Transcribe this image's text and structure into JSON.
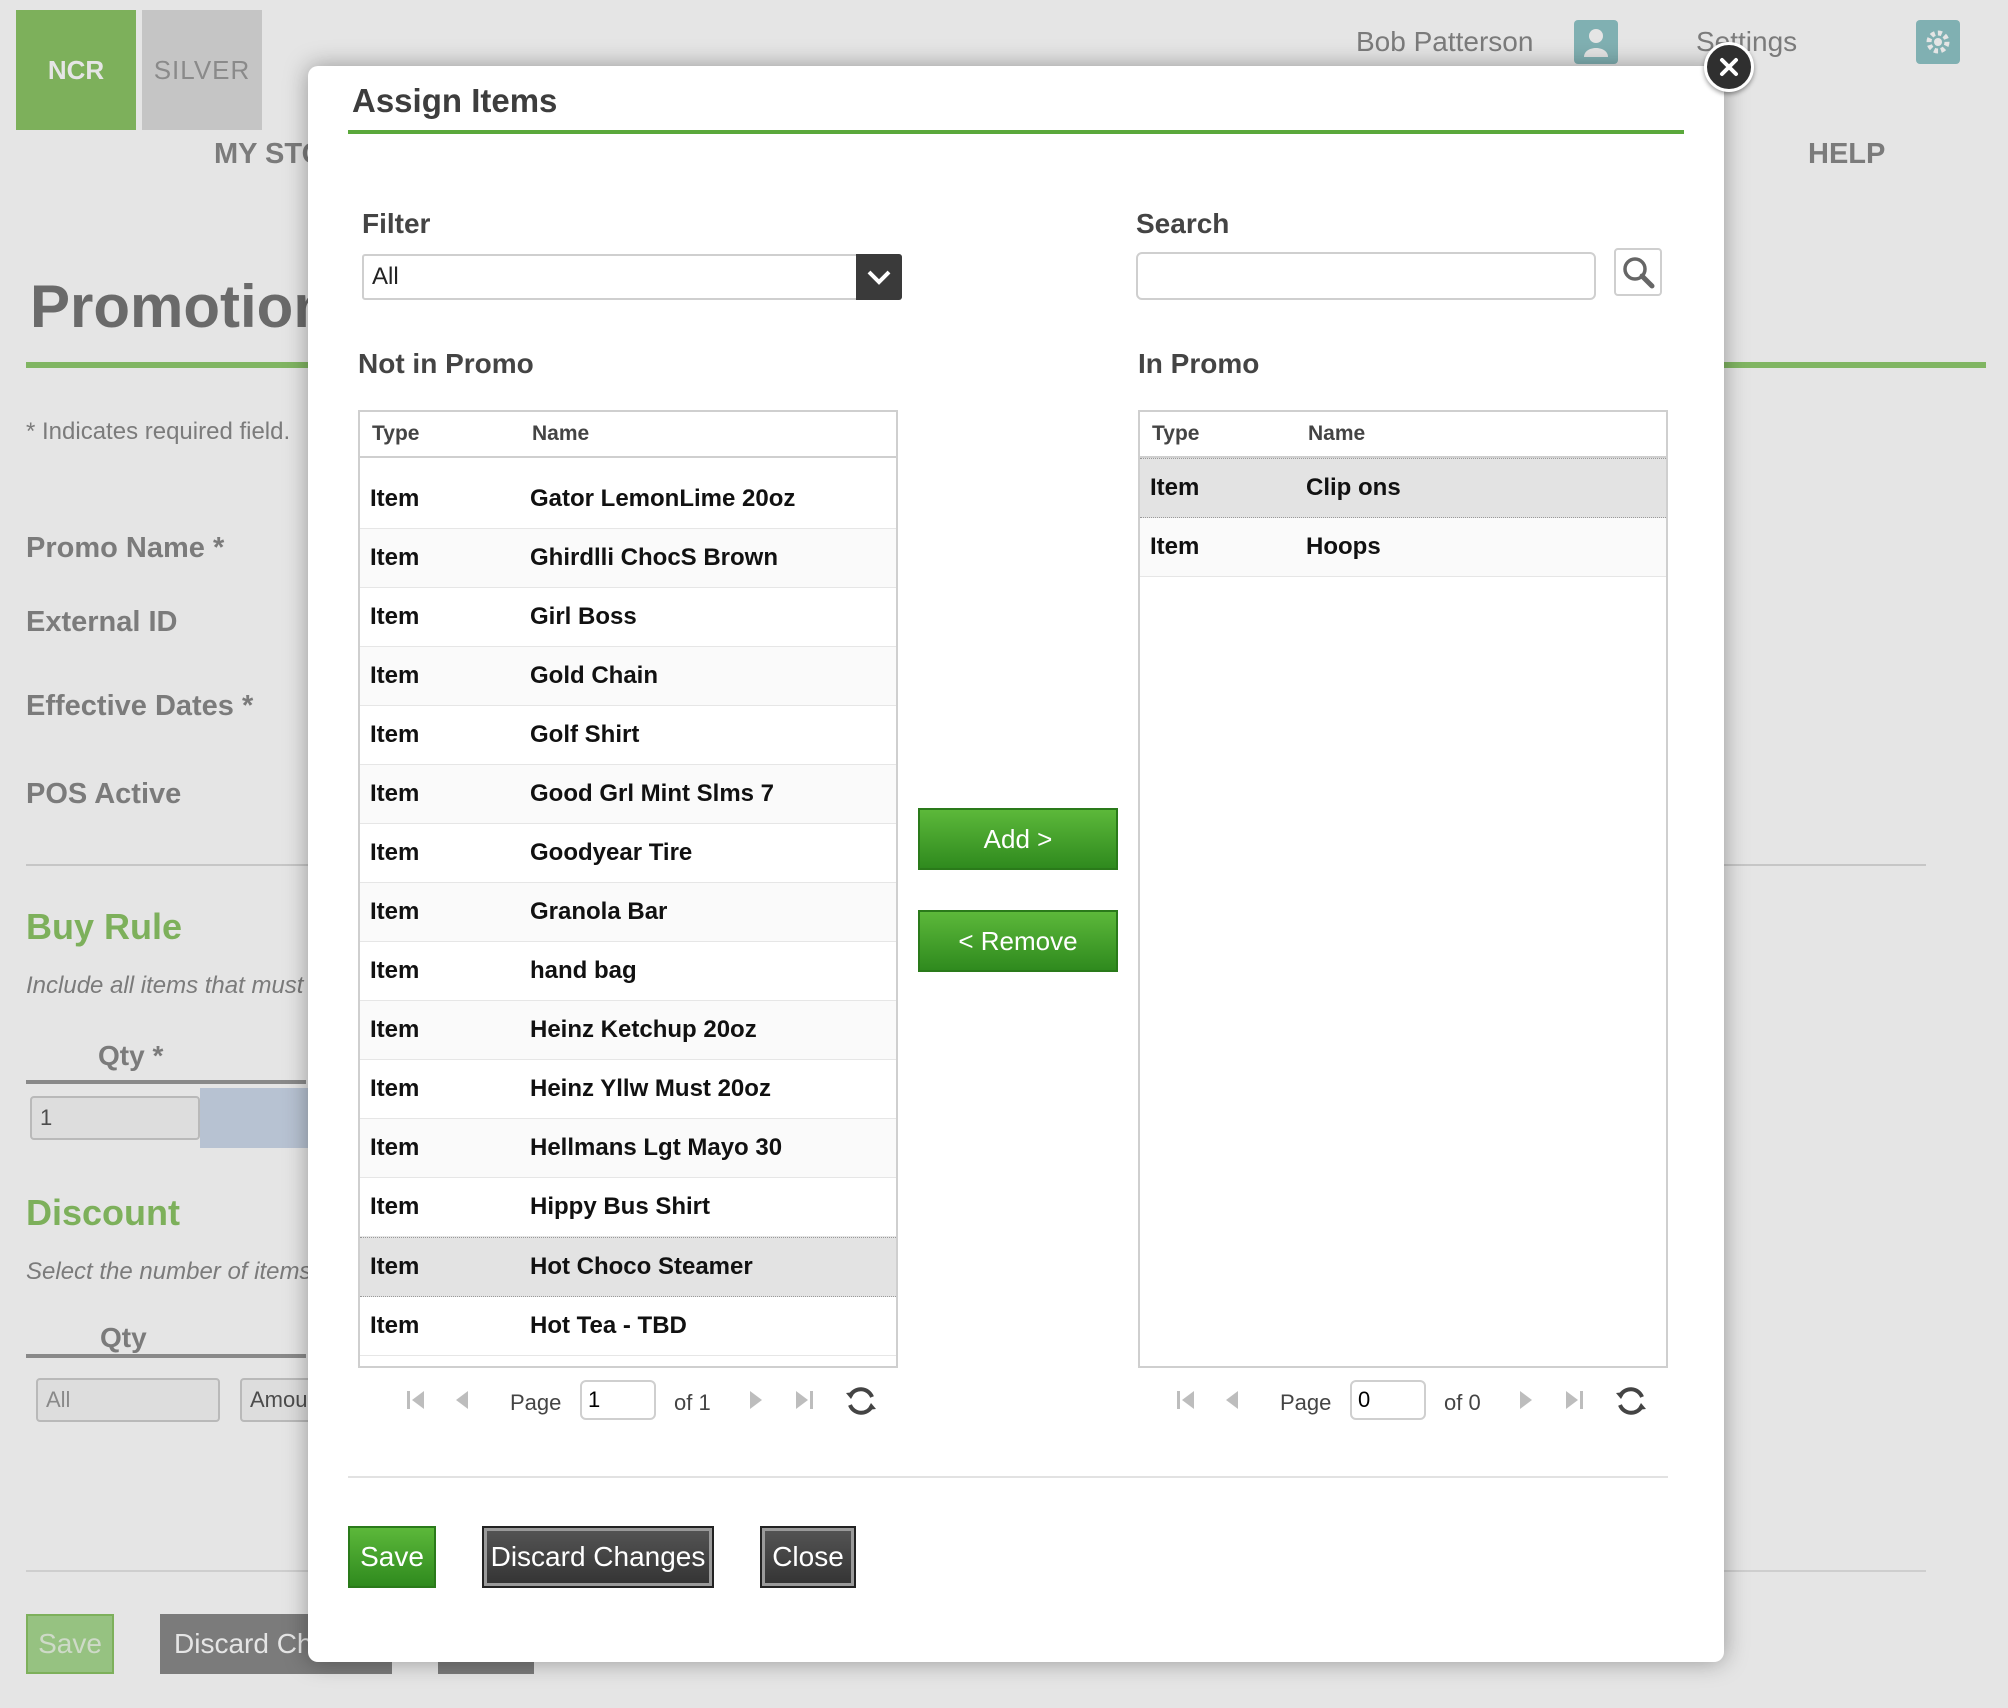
{
  "background": {
    "logo_ncr": "NCR",
    "logo_silver": "SILVER",
    "user_name": "Bob Patterson",
    "settings_label": "Settings",
    "nav_my_store": "MY STO",
    "nav_help": "HELP",
    "page_title": "Promotion",
    "required_note": "* Indicates required field.",
    "promo_name_label": "Promo Name *",
    "external_id_label": "External ID",
    "effective_dates_label": "Effective Dates *",
    "pos_active_label": "POS Active",
    "buy_rule_heading": "Buy Rule",
    "buy_rule_desc": "Include all items that must",
    "qty_required_label": "Qty *",
    "qty_value": "1",
    "discount_heading": "Discount",
    "discount_desc": "Select the number of items",
    "discount_qty_label": "Qty",
    "discount_qty_value": "All",
    "amount_label": "Amou",
    "save_label": "Save",
    "discard_label": "Discard Ch"
  },
  "modal": {
    "title": "Assign Items",
    "filter_label": "Filter",
    "filter_value": "All",
    "search_label": "Search",
    "search_value": "",
    "not_in_promo_label": "Not in Promo",
    "in_promo_label": "In Promo",
    "col_type": "Type",
    "col_name": "Name",
    "not_in_promo_rows": [
      {
        "type": "Item",
        "name": "Gator LemonLime 20oz"
      },
      {
        "type": "Item",
        "name": "Ghirdlli ChocS Brown"
      },
      {
        "type": "Item",
        "name": "Girl Boss"
      },
      {
        "type": "Item",
        "name": "Gold Chain"
      },
      {
        "type": "Item",
        "name": "Golf Shirt"
      },
      {
        "type": "Item",
        "name": "Good Grl Mint Slms 7"
      },
      {
        "type": "Item",
        "name": "Goodyear Tire"
      },
      {
        "type": "Item",
        "name": "Granola Bar"
      },
      {
        "type": "Item",
        "name": "hand bag"
      },
      {
        "type": "Item",
        "name": "Heinz Ketchup 20oz"
      },
      {
        "type": "Item",
        "name": "Heinz Yllw Must 20oz"
      },
      {
        "type": "Item",
        "name": "Hellmans Lgt Mayo 30"
      },
      {
        "type": "Item",
        "name": "Hippy Bus Shirt"
      },
      {
        "type": "Item",
        "name": "Hot Choco Steamer"
      },
      {
        "type": "Item",
        "name": "Hot Tea - TBD"
      }
    ],
    "selected_not_in_promo_index": 13,
    "in_promo_rows": [
      {
        "type": "Item",
        "name": "Clip ons"
      },
      {
        "type": "Item",
        "name": "Hoops"
      }
    ],
    "selected_in_promo_index": 0,
    "add_label": "Add >",
    "remove_label": "< Remove",
    "left_pager": {
      "page_label": "Page",
      "page_value": "1",
      "of_label": "of 1"
    },
    "right_pager": {
      "page_label": "Page",
      "page_value": "0",
      "of_label": "of 0"
    },
    "save_label": "Save",
    "discard_label": "Discard Changes",
    "close_label": "Close"
  },
  "colors": {
    "accent_green": "#5aa83b",
    "logo_green": "#8cc466",
    "button_dark": "#333333"
  }
}
